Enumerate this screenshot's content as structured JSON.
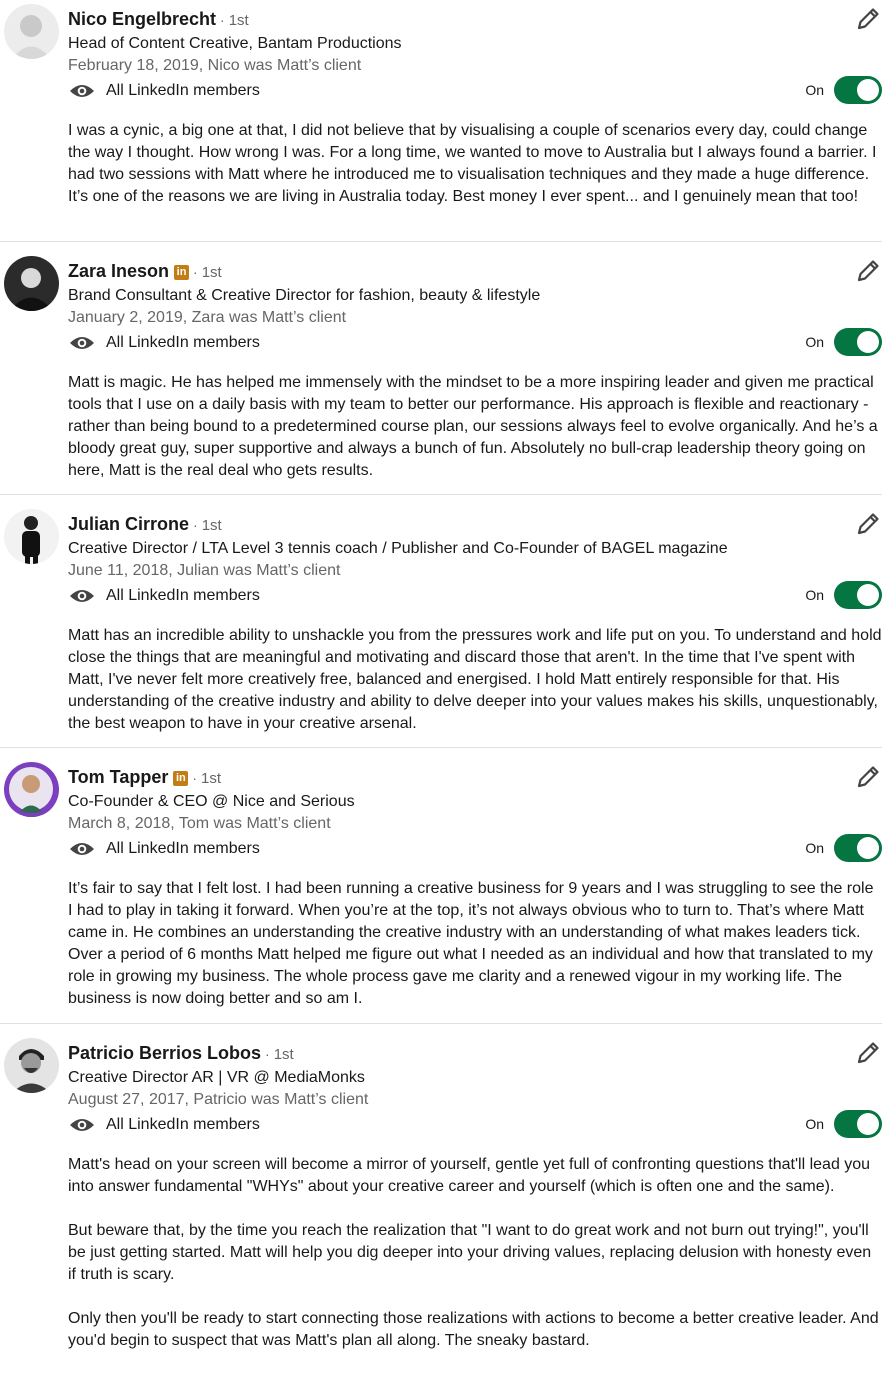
{
  "visibility_label": "All LinkedIn members",
  "toggle_label": "On",
  "recommendations": [
    {
      "name": "Nico Engelbrecht",
      "degree": "1st",
      "badge": "",
      "headline": "Head of Content Creative, Bantam Productions",
      "date": "February 18, 2019, Nico was Matt’s client",
      "text": [
        "I was a cynic, a big one at that, I did not believe that by visualising a couple of scenarios every day, could change the way I thought. How wrong I was. For a long time, we wanted to move to Australia but I always found a barrier. I had two sessions with Matt where he introduced me to visualisation techniques and they made a huge difference. It’s one of the reasons we are living in Australia today. Best money I ever spent... and I genuinely mean that too!"
      ]
    },
    {
      "name": "Zara Ineson",
      "degree": "1st",
      "badge": "in",
      "headline": "Brand Consultant & Creative Director for fashion, beauty & lifestyle",
      "date": "January 2, 2019, Zara was Matt’s client",
      "text": [
        "Matt is magic. He has helped me immensely with the mindset to be a more inspiring leader and given me practical tools that I use on a daily basis with my team to better our performance. His approach is flexible and reactionary - rather than being bound to a predetermined course plan, our sessions always feel to evolve organically. And he’s a bloody great guy, super supportive and always a bunch of fun. Absolutely no bull-crap leadership theory going on here, Matt is the real deal who gets results."
      ]
    },
    {
      "name": "Julian Cirrone",
      "degree": "1st",
      "badge": "",
      "headline": "Creative Director / LTA Level 3 tennis coach / Publisher and Co-Founder of BAGEL magazine",
      "date": "June 11, 2018, Julian was Matt’s client",
      "text": [
        "Matt has an incredible ability to unshackle you from the pressures work and life put on you. To understand and hold close the things that are meaningful and motivating and discard those that aren't. In the time that I've spent with Matt, I've never felt more creatively free, balanced and energised. I hold Matt entirely responsible for that. His understanding of the creative industry and ability to delve deeper into your values makes his skills, unquestionably, the best weapon to have in your creative arsenal."
      ]
    },
    {
      "name": "Tom Tapper",
      "degree": "1st",
      "badge": "in",
      "headline": "Co-Founder & CEO @ Nice and Serious",
      "date": "March 8, 2018, Tom was Matt’s client",
      "text": [
        "It’s fair to say that I felt lost. I had been running a creative business for 9 years and I was struggling to see the role I had to play in taking it forward. When you’re at the top, it’s not always obvious who to turn to. That’s where Matt came in. He combines an understanding the creative industry with an understanding of what makes leaders tick. Over a period of 6 months Matt helped me figure out what I needed as an individual and how that translated to my role in growing my business. The whole process gave me clarity and a renewed vigour in my working life. The business is now doing better and so am I."
      ]
    },
    {
      "name": "Patricio Berrios Lobos",
      "degree": "1st",
      "badge": "",
      "headline": "Creative Director AR | VR @ MediaMonks",
      "date": "August 27, 2017, Patricio was Matt’s client",
      "text": [
        "Matt's head on your screen will become a mirror of yourself, gentle yet full of confronting questions that'll lead you into answer fundamental \"WHYs\" about your creative career and yourself (which is often one and the same).",
        "But beware that, by the time you reach the realization that \"I want to do great work and not burn out trying!\", you'll be just getting started. Matt will help you dig deeper into your driving values, replacing delusion with honesty even if truth is scary.",
        "Only then you'll be ready to start connecting those realizations with actions to become a better creative leader. And you'd begin to suspect that was Matt's plan all along. The sneaky bastard."
      ]
    }
  ]
}
